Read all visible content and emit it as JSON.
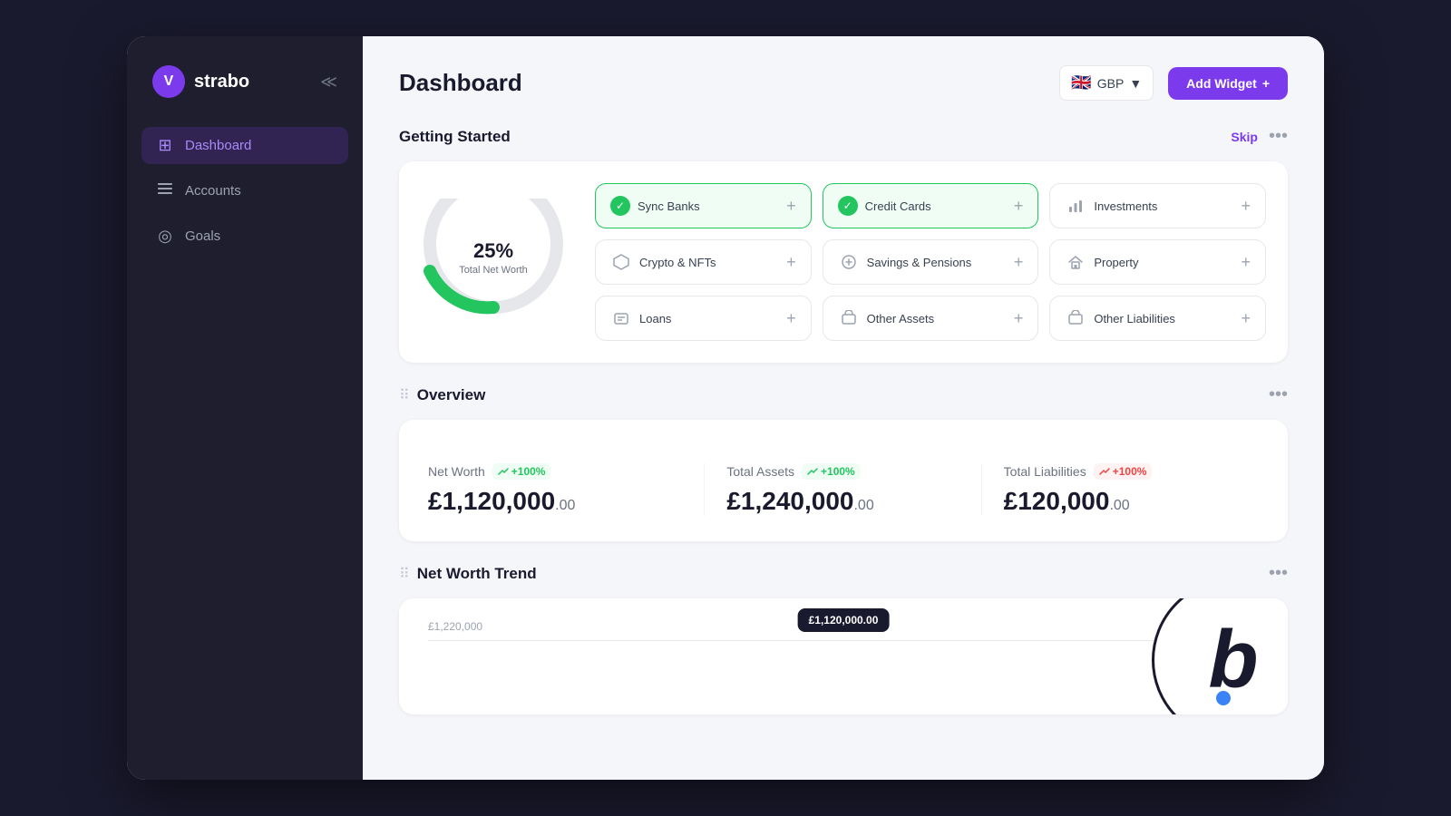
{
  "app": {
    "name": "strabo",
    "logo_symbol": "V"
  },
  "sidebar": {
    "collapse_icon": "«»",
    "items": [
      {
        "id": "dashboard",
        "label": "Dashboard",
        "icon": "⊞",
        "active": true
      },
      {
        "id": "accounts",
        "label": "Accounts",
        "icon": "≡"
      },
      {
        "id": "goals",
        "label": "Goals",
        "icon": "◎"
      }
    ]
  },
  "header": {
    "title": "Dashboard",
    "currency": {
      "flag": "🇬🇧",
      "code": "GBP",
      "chevron": "▼"
    },
    "add_widget_label": "Add Widget",
    "add_widget_plus": "+"
  },
  "getting_started": {
    "title": "Getting Started",
    "skip_label": "Skip",
    "more_icon": "···",
    "donut": {
      "percent": "25%",
      "label": "Total Net Worth"
    },
    "widgets": [
      {
        "id": "sync-banks",
        "label": "Sync Banks",
        "active": true,
        "icon": "🏦"
      },
      {
        "id": "credit-cards",
        "label": "Credit Cards",
        "active": true,
        "icon": "💳"
      },
      {
        "id": "investments",
        "label": "Investments",
        "active": false,
        "icon": "📊"
      },
      {
        "id": "crypto-nfts",
        "label": "Crypto & NFTs",
        "active": false,
        "icon": "🔷"
      },
      {
        "id": "savings-pensions",
        "label": "Savings & Pensions",
        "active": false,
        "icon": "🛡️"
      },
      {
        "id": "property",
        "label": "Property",
        "active": false,
        "icon": "🏠"
      },
      {
        "id": "loans",
        "label": "Loans",
        "active": false,
        "icon": "📋"
      },
      {
        "id": "other-assets",
        "label": "Other Assets",
        "active": false,
        "icon": "📦"
      },
      {
        "id": "other-liabilities",
        "label": "Other Liabilities",
        "active": false,
        "icon": "📦"
      }
    ]
  },
  "overview": {
    "title": "Overview",
    "more_icon": "···",
    "drag_icon": "⠿",
    "items": [
      {
        "id": "net-worth",
        "label": "Net Worth",
        "trend_icon": "↗",
        "trend_value": "+100%",
        "trend_type": "green",
        "amount": "£1,120,000",
        "cents": ".00"
      },
      {
        "id": "total-assets",
        "label": "Total Assets",
        "trend_icon": "↗",
        "trend_value": "+100%",
        "trend_type": "green",
        "amount": "£1,240,000",
        "cents": ".00"
      },
      {
        "id": "total-liabilities",
        "label": "Total Liabilities",
        "trend_icon": "↗",
        "trend_value": "+100%",
        "trend_type": "red",
        "amount": "£120,000",
        "cents": ".00"
      }
    ]
  },
  "net_worth_trend": {
    "title": "Net Worth Trend",
    "drag_icon": "⠿",
    "more_icon": "···",
    "chart_label": "£1,220,000",
    "tooltip_value": "£1,120,000.00"
  }
}
